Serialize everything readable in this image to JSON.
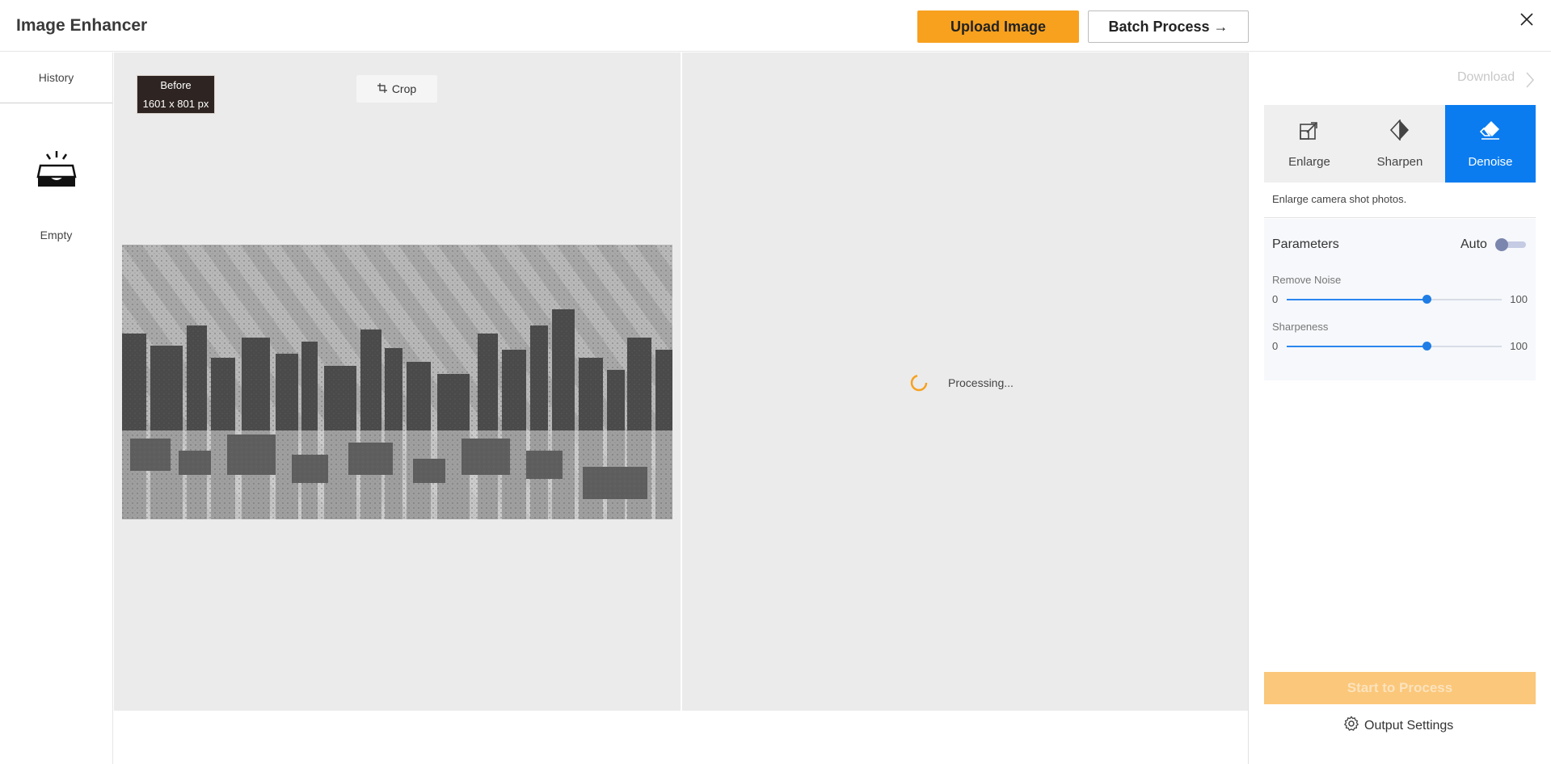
{
  "header": {
    "title": "Image Enhancer",
    "upload_label": "Upload Image",
    "batch_label": "Batch Process →",
    "close_icon": "close-icon"
  },
  "history": {
    "title": "History",
    "empty_label": "Empty",
    "empty_icon": "empty-inbox-icon"
  },
  "before": {
    "badge_title": "Before",
    "badge_size": "1601 x 801 px",
    "crop_label": "Crop",
    "crop_icon": "crop-icon"
  },
  "after": {
    "status": "Processing...",
    "spinner_icon": "spinner-icon"
  },
  "sidebar": {
    "download_label": "Download",
    "tools": [
      {
        "label": "Enlarge",
        "icon": "enlarge-icon",
        "active": false
      },
      {
        "label": "Sharpen",
        "icon": "sharpen-icon",
        "active": false
      },
      {
        "label": "Denoise",
        "icon": "eraser-icon",
        "active": true
      }
    ],
    "description": "Enlarge camera shot photos.",
    "params": {
      "title": "Parameters",
      "auto_label": "Auto",
      "auto_on": false,
      "sliders": [
        {
          "label": "Remove Noise",
          "min": "0",
          "max": "100",
          "value": 65
        },
        {
          "label": "Sharpeness",
          "min": "0",
          "max": "100",
          "value": 65
        }
      ]
    },
    "start_label": "Start to Process",
    "output_settings_label": "Output Settings"
  },
  "colors": {
    "accent_orange": "#f7a11f",
    "active_blue": "#0a7cf0",
    "slider_blue": "#1f7de6",
    "pane_gray": "#ebebeb"
  }
}
